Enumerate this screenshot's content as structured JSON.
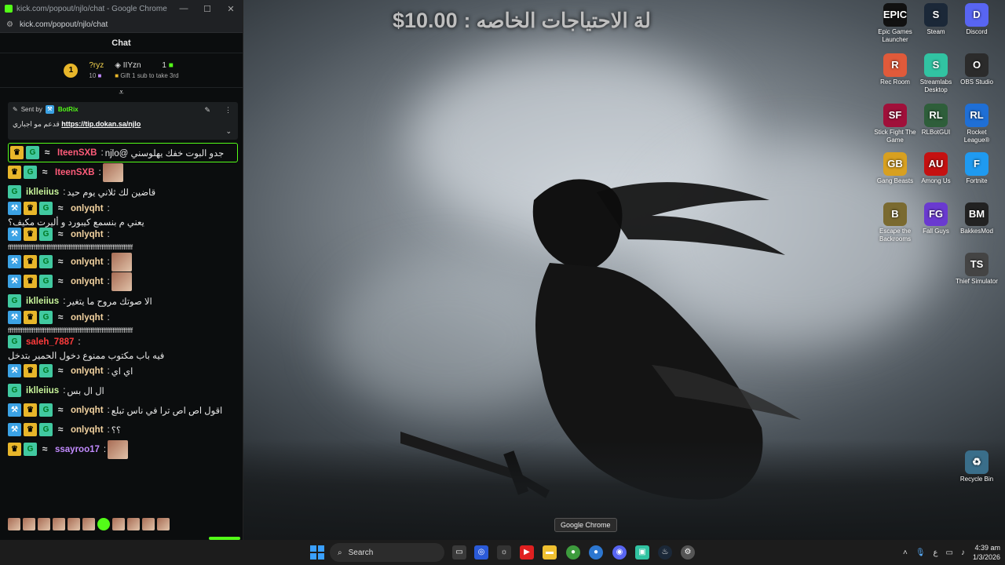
{
  "browser": {
    "window_title": "kick.com/popout/njlo/chat - Google Chrome",
    "url": "kick.com/popout/njlo/chat"
  },
  "chat": {
    "header": "Chat",
    "leaderboard": {
      "rank": "1",
      "user1": "?ryz",
      "user1_count": "10",
      "user2": "IIYzn",
      "user2_subtext": "Gift 1 sub to take 3rd",
      "user2_count": "1"
    },
    "pinned": {
      "sent_by_label": "Sent by",
      "sender": "BotRix",
      "message": "قدعم مو اجباري",
      "link": "https://tip.dokan.sa/njlo"
    },
    "messages": [
      {
        "user": "IteenSXB",
        "text": "جدو البوت خفك يهلوسني @njlo",
        "color": "#ff5c7a",
        "highlight": true
      },
      {
        "user": "IteenSXB",
        "text": "",
        "color": "#ff5c7a",
        "emote": true
      },
      {
        "user": "iklleiius",
        "text": "قاضين لك ثلاني يوم حيد",
        "color": "#c8f59a"
      },
      {
        "user": "onlyqht",
        "text": "يعني م بنسمع كيبورد و أليرت مكيف؟",
        "color": "#f3d3a0"
      },
      {
        "user": "onlyqht",
        "text": "",
        "color": "#f3d3a0",
        "wrap": "ffffffffffffffffffffffffffffffffffffffffffffffffffffffffffffffffffff"
      },
      {
        "user": "onlyqht",
        "text": "",
        "color": "#f3d3a0",
        "emote": true
      },
      {
        "user": "onlyqht",
        "text": "",
        "color": "#f3d3a0",
        "emote": true
      },
      {
        "user": "iklleiius",
        "text": "الا صوتك مروح ما يتغير",
        "color": "#c8f59a"
      },
      {
        "user": "onlyqht",
        "text": "",
        "color": "#f3d3a0",
        "wrap": "ffffffffffffffffffffffffffffffffffffffffffffffffffffffffffffffffffff"
      },
      {
        "user": "saleh_7887",
        "text": "فيه باب مكتوب ممنوع دخول الحمير بتدخل",
        "color": "#ff3b3b"
      },
      {
        "user": "onlyqht",
        "text": "اي اي",
        "color": "#f3d3a0"
      },
      {
        "user": "iklleiius",
        "text": "ال ال بس",
        "color": "#c8f59a"
      },
      {
        "user": "onlyqht",
        "text": "اقول اص اص ترا في ناس تبلع",
        "color": "#f3d3a0"
      },
      {
        "user": "onlyqht",
        "text": "؟؟",
        "color": "#f3d3a0"
      },
      {
        "user": "ssayroo17",
        "text": "",
        "color": "#c28bff",
        "emote": true
      }
    ]
  },
  "overlay": {
    "amount": "$10.00",
    "text": "لة الاحتياجات الخاصه :"
  },
  "desktop_icons": [
    {
      "label": "Epic Games Launcher",
      "icon": "epic-icon",
      "short": "EPIC",
      "bg": "#111111"
    },
    {
      "label": "Steam",
      "icon": "steam-icon",
      "short": "S",
      "bg": "#1b2838"
    },
    {
      "label": "Discord",
      "icon": "discord-icon",
      "short": "D",
      "bg": "#5865f2"
    },
    {
      "label": "Rec Room",
      "icon": "recroom-icon",
      "short": "R",
      "bg": "#e05a3a"
    },
    {
      "label": "Streamlabs Desktop",
      "icon": "streamlabs-icon",
      "short": "S",
      "bg": "#31c3a2"
    },
    {
      "label": "OBS Studio",
      "icon": "obs-icon",
      "short": "O",
      "bg": "#2b2b2b"
    },
    {
      "label": "Stick Fight The Game",
      "icon": "stickfight-icon",
      "short": "SF",
      "bg": "#a0103a"
    },
    {
      "label": "RLBotGUI",
      "icon": "rlbot-icon",
      "short": "RL",
      "bg": "#2e5e3a"
    },
    {
      "label": "Rocket League®",
      "icon": "rocketleague-icon",
      "short": "RL",
      "bg": "#1f6fd6"
    },
    {
      "label": "Gang Beasts",
      "icon": "gangbeasts-icon",
      "short": "GB",
      "bg": "#d8a020"
    },
    {
      "label": "Among Us",
      "icon": "amongus-icon",
      "short": "AU",
      "bg": "#c51111"
    },
    {
      "label": "Fortnite",
      "icon": "fortnite-icon",
      "short": "F",
      "bg": "#1f9af0"
    },
    {
      "label": "Escape the Backrooms",
      "icon": "backrooms-icon",
      "short": "B",
      "bg": "#7a6a30"
    },
    {
      "label": "Fall Guys",
      "icon": "fallguys-icon",
      "short": "FG",
      "bg": "#6a3ad0"
    },
    {
      "label": "BakkesMod",
      "icon": "bakkesmod-icon",
      "short": "BM",
      "bg": "#222222"
    },
    {
      "label": "Thief Simulator",
      "icon": "thief-icon",
      "short": "TS",
      "bg": "#444444"
    },
    {
      "label": "Recycle Bin",
      "icon": "recycle-bin-icon",
      "short": "♻",
      "bg": "#3a6e8a"
    }
  ],
  "tooltip": "Google Chrome",
  "taskbar": {
    "search_label": "Search",
    "time": "4:39 am",
    "date": "1/3/2026",
    "lang": "ع"
  }
}
